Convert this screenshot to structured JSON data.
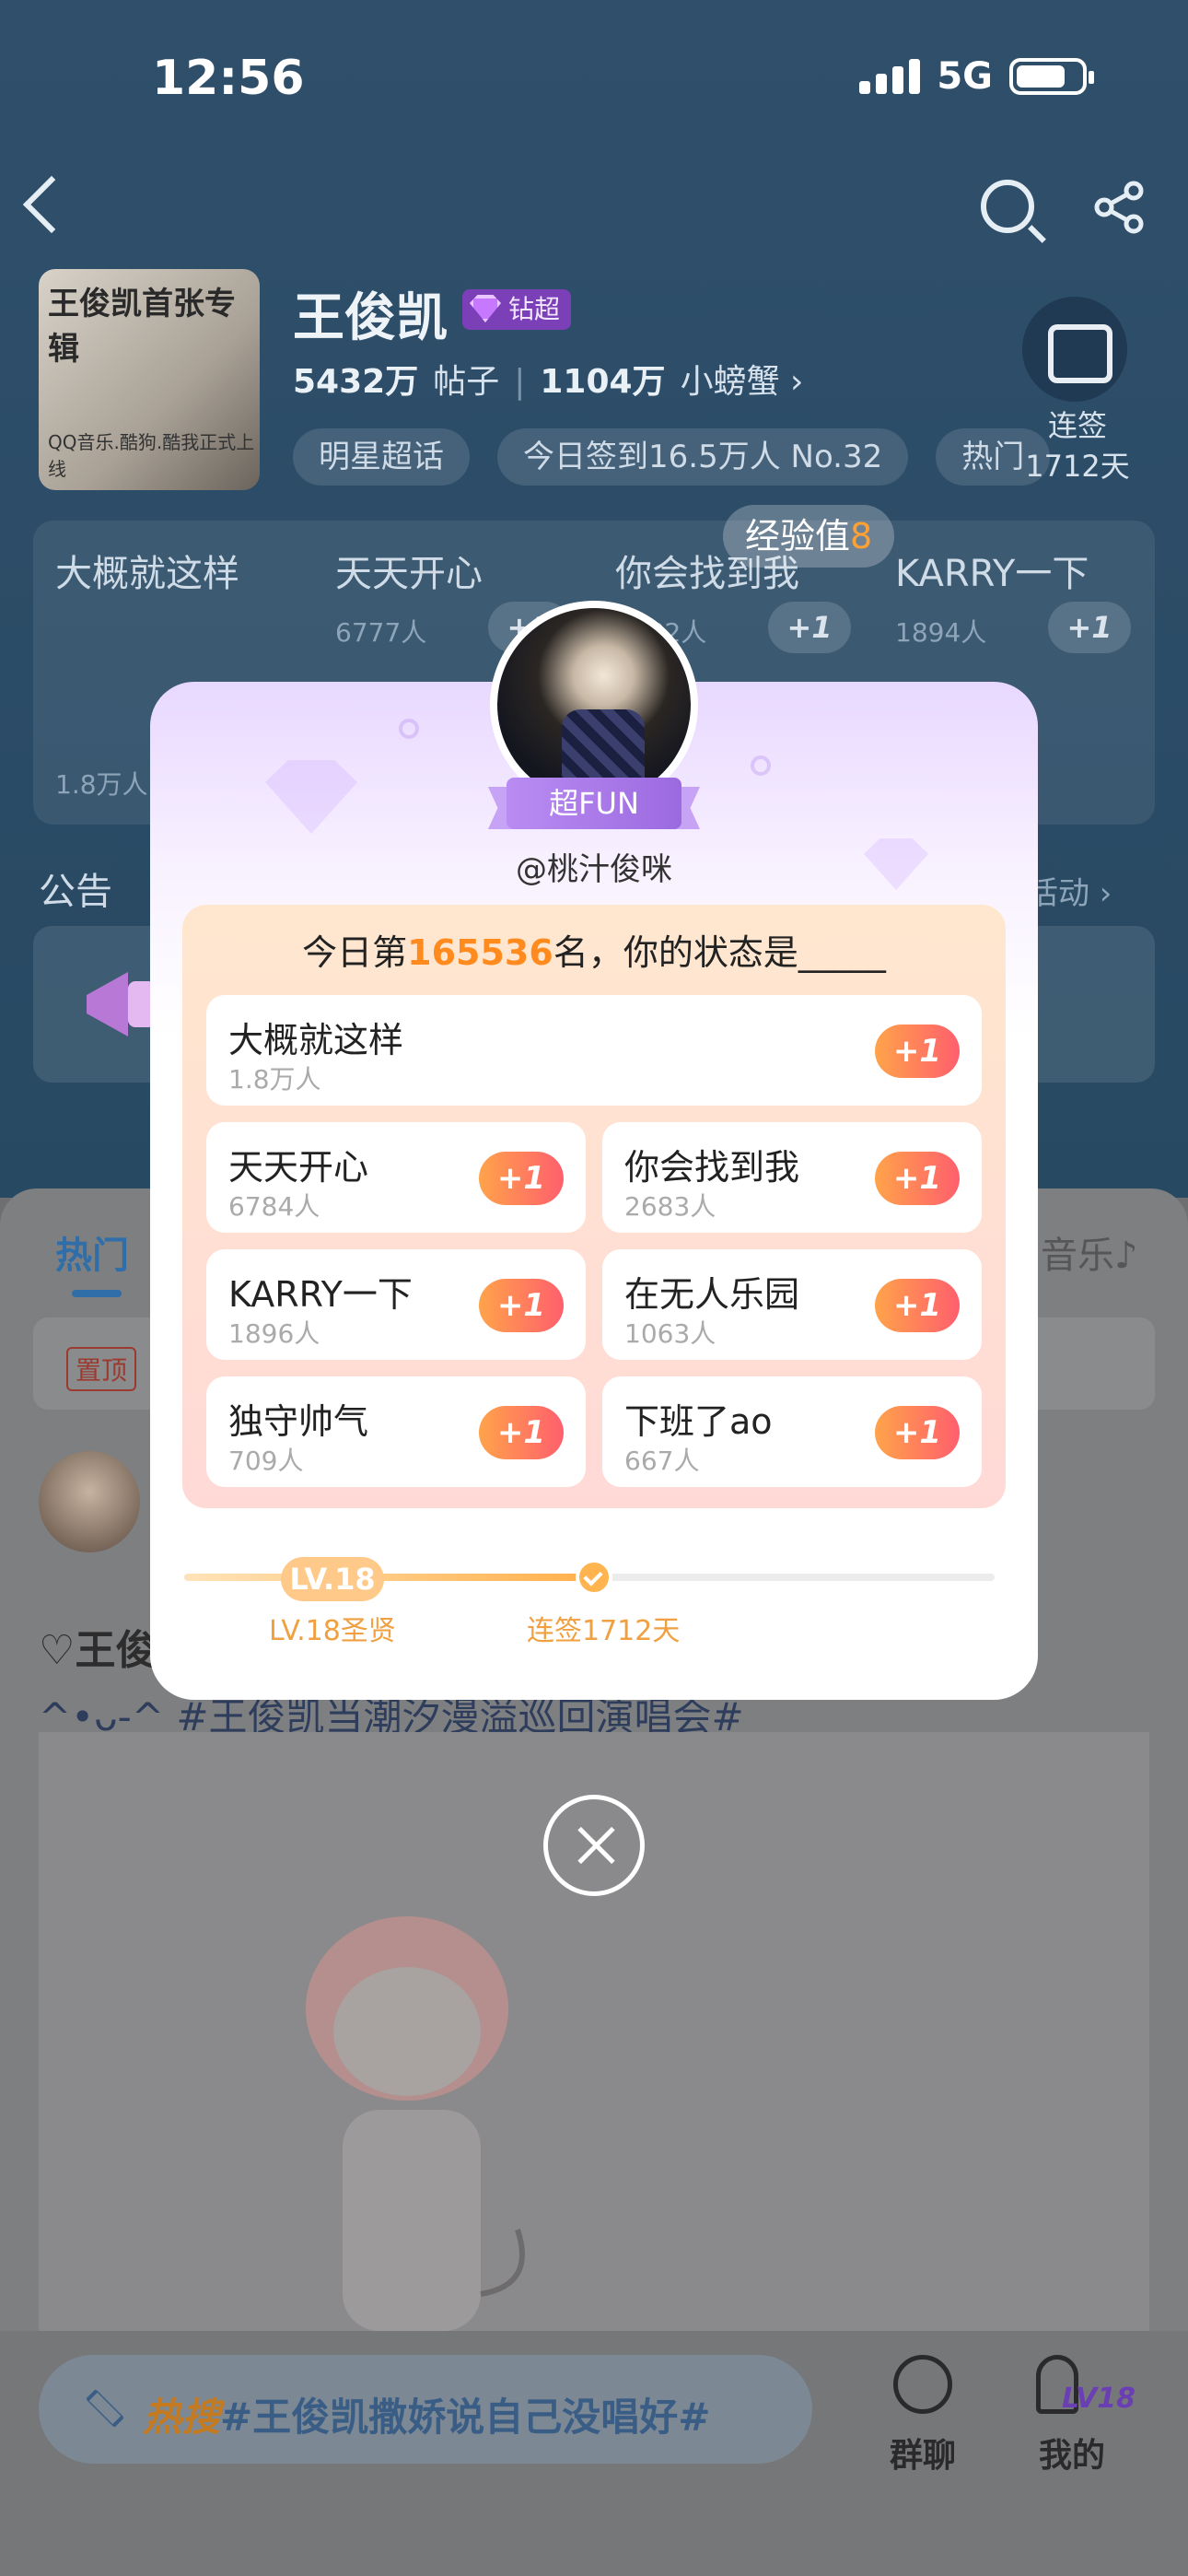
{
  "status_bar": {
    "time": "12:56",
    "network": "5G"
  },
  "topic": {
    "cover_title": "王俊凯首张专辑",
    "cover_subtitle": "QQ音乐.酷狗.酷我正式上线",
    "name": "王俊凯",
    "badge": "钻超",
    "posts_count": "5432万",
    "posts_label": "帖子",
    "fans_count": "1104万",
    "fans_label": "小螃蟹 ›",
    "chips": [
      "明星超话",
      "今日签到16.5万人 No.32",
      "热门"
    ],
    "checkin_label": "连签",
    "checkin_days": "1712天"
  },
  "bg_status_card": [
    {
      "title": "大概就这样",
      "count": "1.8万人"
    },
    {
      "title": "天天开心",
      "count": "6777人",
      "plus": "+1"
    },
    {
      "title": "你会找到我",
      "count": "2682人",
      "plus": "+1"
    },
    {
      "title": "KARRY一下",
      "count": "1894人",
      "plus": "+1"
    }
  ],
  "exp_toast": {
    "label": "经验值",
    "value": "8"
  },
  "notice": {
    "title": "公告",
    "more": "活动 ›"
  },
  "feed": {
    "tab_hot": "热门",
    "tab_music": "音乐♪",
    "pinned": "置顶",
    "post_line1": "♡王俊",
    "post_line2": "^•ᴗ-^ #王俊凯当潮汐漫溢巡回演唱会#"
  },
  "bottom_bar": {
    "search_hot": "热搜",
    "search_text": "#王俊凯撒娇说自己没唱好#",
    "group_chat": "群聊",
    "mine": "我的",
    "level_badge": "LV18"
  },
  "modal": {
    "ribbon": "超FUN",
    "username": "@桃汁俊咪",
    "rank_prefix": "今日第",
    "rank_number": "165536",
    "rank_suffix": "名，你的状态是_____",
    "options": [
      {
        "name": "大概就这样",
        "count": "1.8万人",
        "plus": "+1"
      },
      {
        "name": "天天开心",
        "count": "6784人",
        "plus": "+1"
      },
      {
        "name": "你会找到我",
        "count": "2683人",
        "plus": "+1"
      },
      {
        "name": "KARRY一下",
        "count": "1896人",
        "plus": "+1"
      },
      {
        "name": "在无人乐园",
        "count": "1063人",
        "plus": "+1"
      },
      {
        "name": "独守帅气",
        "count": "709人",
        "plus": "+1"
      },
      {
        "name": "下班了ao",
        "count": "667人",
        "plus": "+1"
      }
    ],
    "level_pill": "LV.18",
    "level_label": "LV.18圣贤",
    "streak_label": "连签1712天"
  }
}
